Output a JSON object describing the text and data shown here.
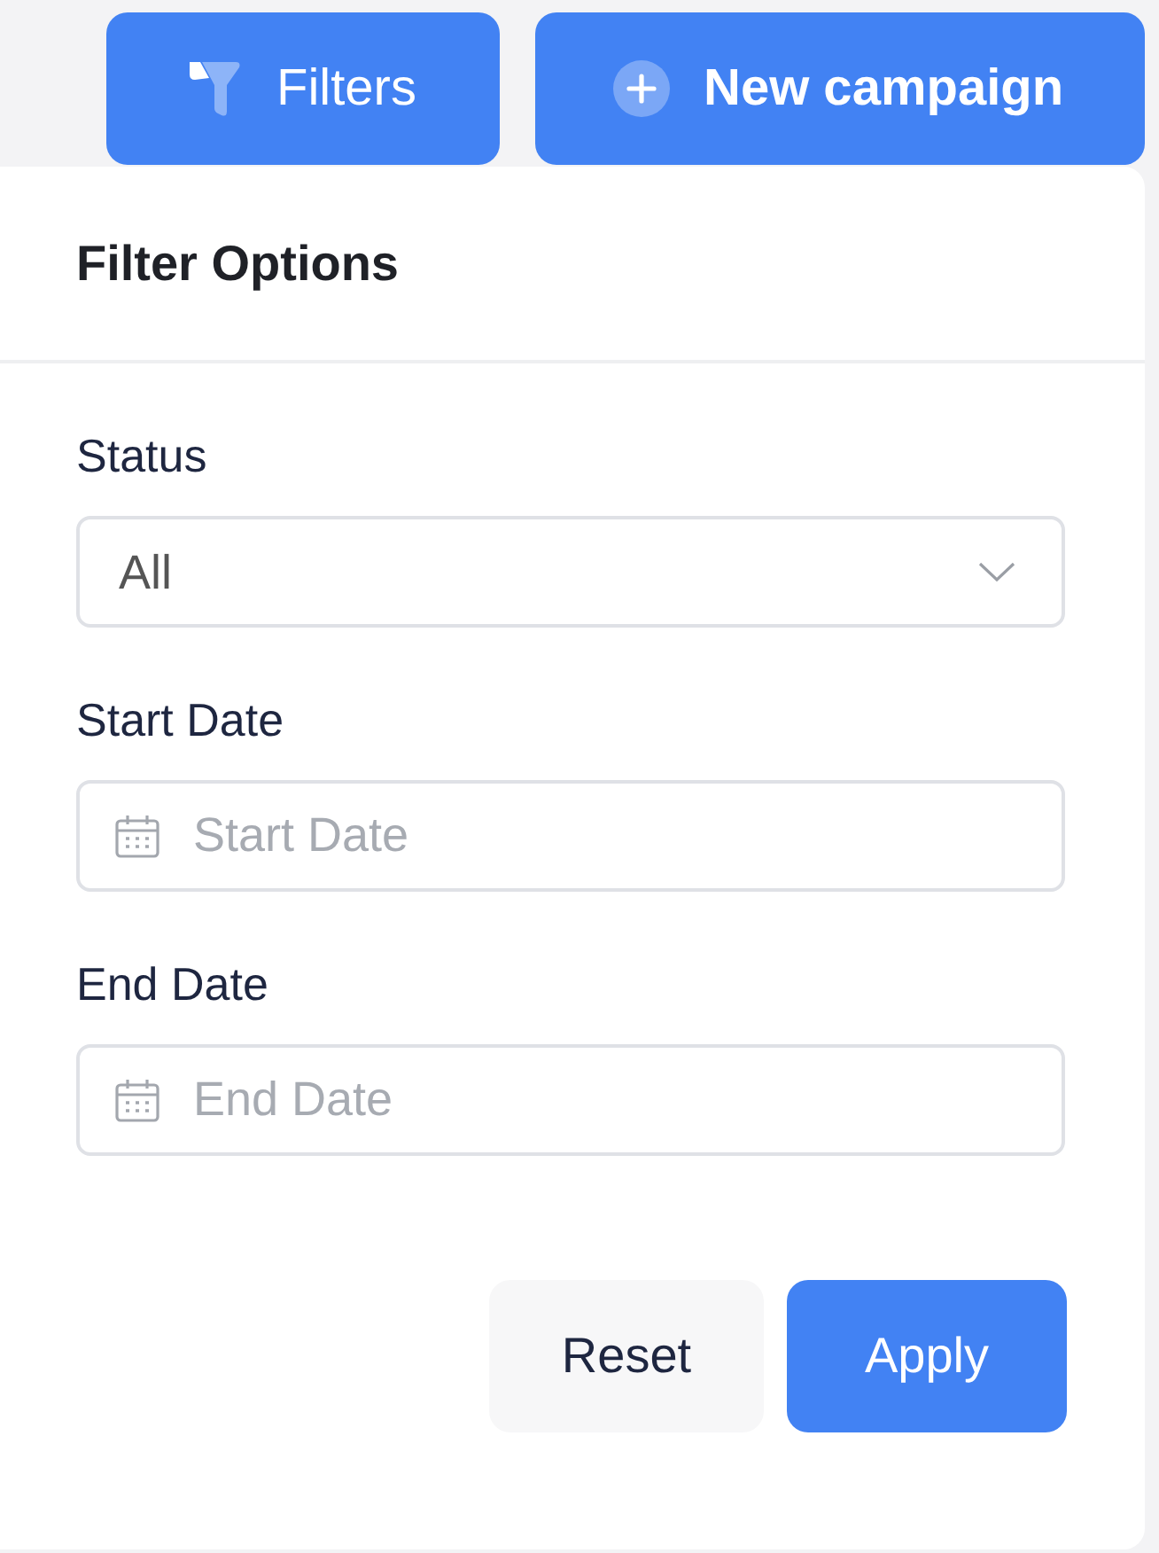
{
  "header_buttons": [
    {
      "kind": "filter",
      "label": "Filters"
    },
    {
      "kind": "add",
      "label": "New campaign"
    }
  ],
  "panel": {
    "title": "Filter Options",
    "fields": [
      {
        "kind": "select",
        "label": "Status",
        "value": "All"
      },
      {
        "kind": "date",
        "label": "Start Date",
        "placeholder": "Start Date"
      },
      {
        "kind": "date",
        "label": "End Date",
        "placeholder": "End Date"
      }
    ],
    "actions": [
      {
        "kind": "secondary",
        "label": "Reset"
      },
      {
        "kind": "primary",
        "label": "Apply"
      }
    ]
  }
}
